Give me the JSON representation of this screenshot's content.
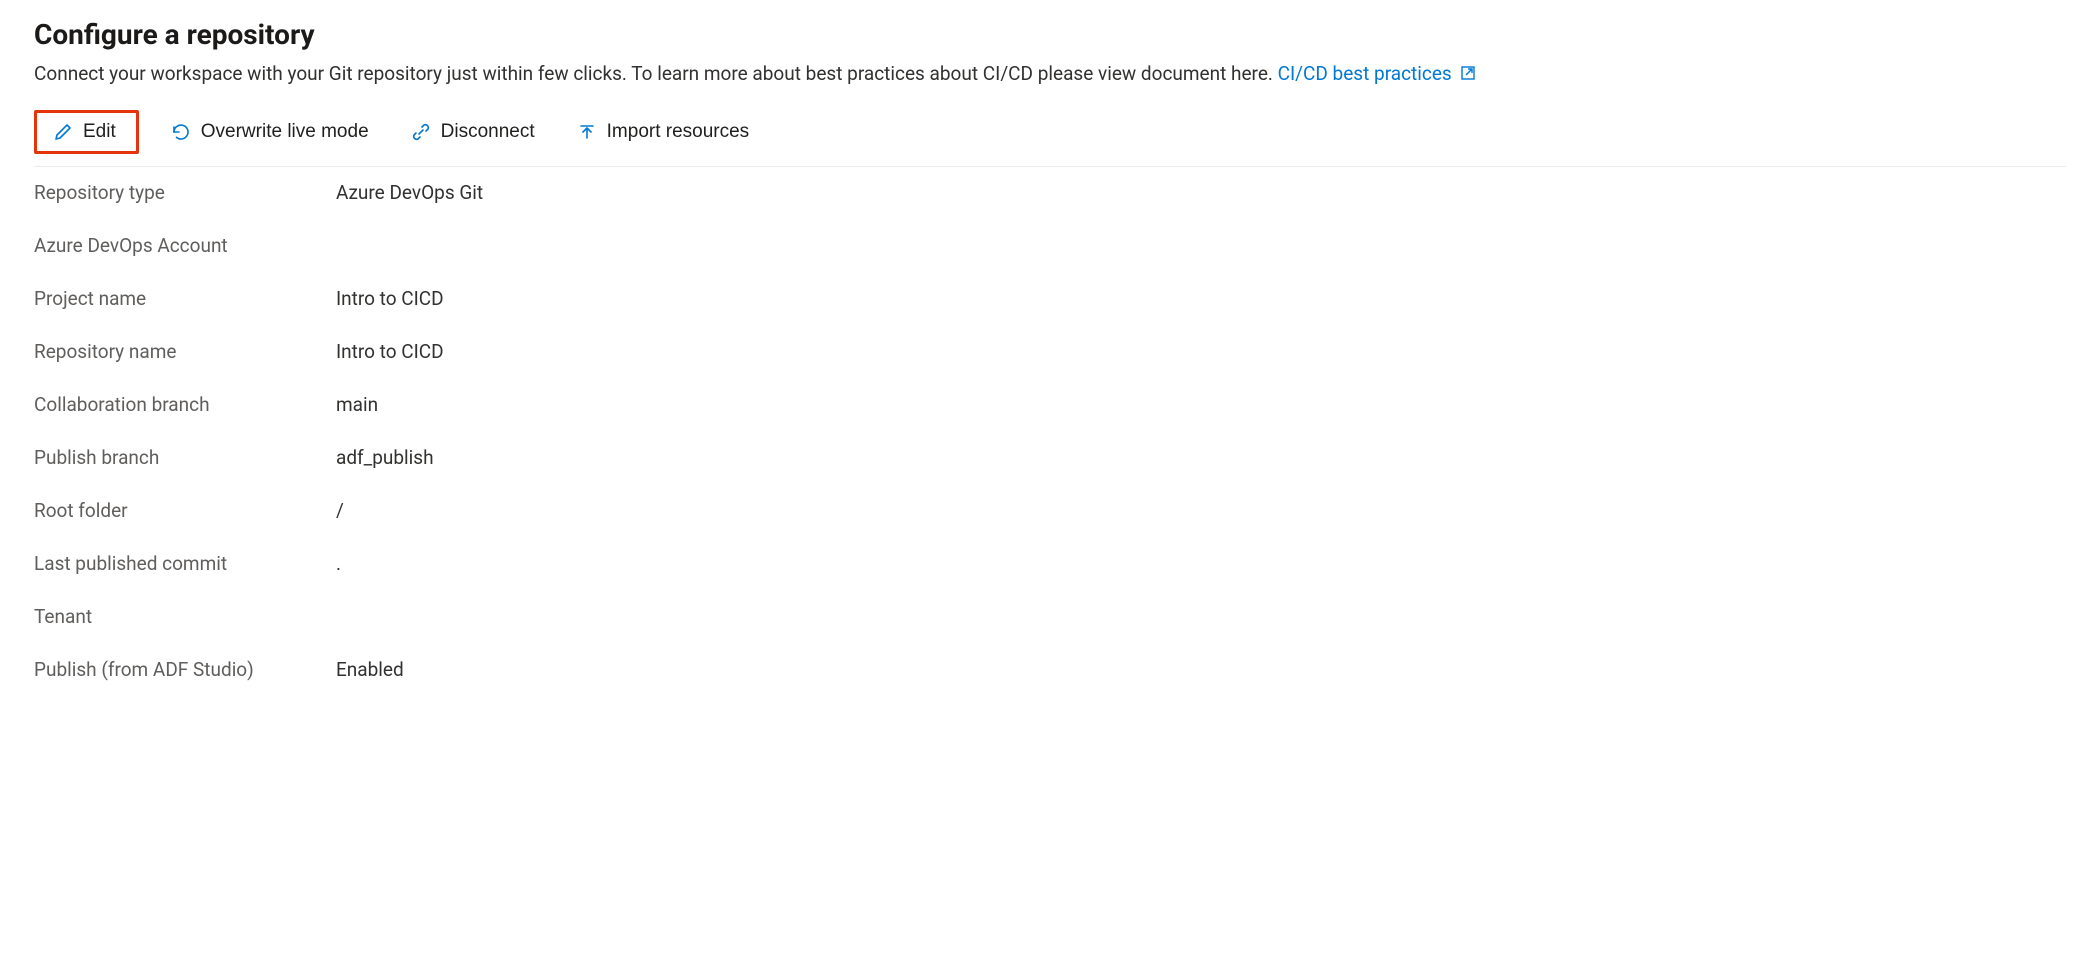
{
  "header": {
    "title": "Configure a repository",
    "subtitle_text": "Connect your workspace with your Git repository just within few clicks. To learn more about best practices about CI/CD please view document here. ",
    "link_label": "CI/CD best practices"
  },
  "toolbar": {
    "edit_label": "Edit",
    "overwrite_label": "Overwrite live mode",
    "disconnect_label": "Disconnect",
    "import_label": "Import resources"
  },
  "details": {
    "repo_type_label": "Repository type",
    "repo_type_value": "Azure DevOps Git",
    "azure_account_label": "Azure DevOps Account",
    "azure_account_value": "",
    "project_name_label": "Project name",
    "project_name_value": "Intro to CICD",
    "repo_name_label": "Repository name",
    "repo_name_value": "Intro to CICD",
    "collab_branch_label": "Collaboration branch",
    "collab_branch_value": "main",
    "publish_branch_label": "Publish branch",
    "publish_branch_value": "adf_publish",
    "root_folder_label": "Root folder",
    "root_folder_value": "/",
    "last_commit_label": "Last published commit",
    "last_commit_value": ".",
    "tenant_label": "Tenant",
    "tenant_value": "",
    "publish_adf_label": "Publish (from ADF Studio)",
    "publish_adf_value": "Enabled"
  }
}
